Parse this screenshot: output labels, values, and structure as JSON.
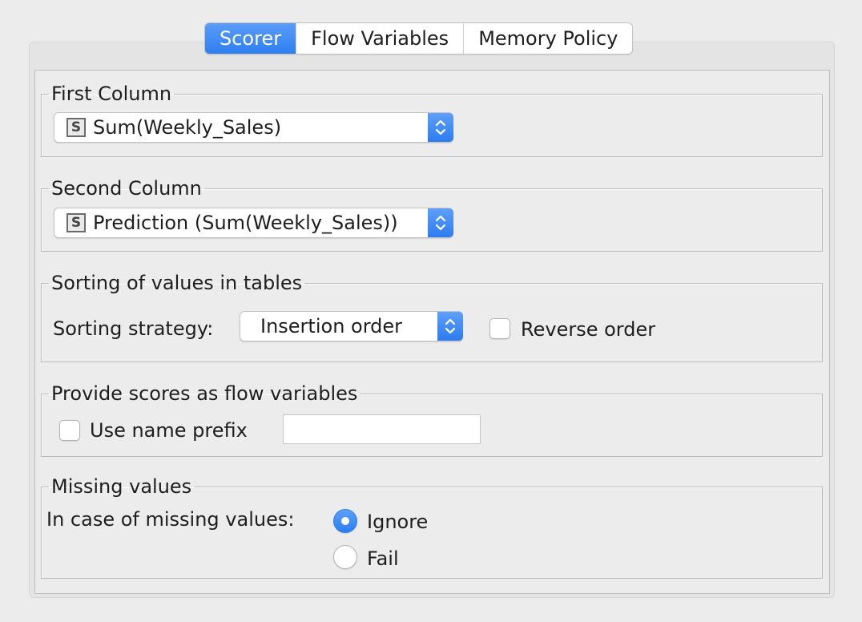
{
  "tabs": [
    {
      "label": "Scorer",
      "active": true
    },
    {
      "label": "Flow Variables",
      "active": false
    },
    {
      "label": "Memory Policy",
      "active": false
    }
  ],
  "first_column": {
    "title": "First Column",
    "type_icon": "S",
    "value": "Sum(Weekly_Sales)"
  },
  "second_column": {
    "title": "Second Column",
    "type_icon": "S",
    "value": "Prediction (Sum(Weekly_Sales))"
  },
  "sorting": {
    "title": "Sorting of values in tables",
    "strategy_label": "Sorting strategy:",
    "strategy_value": "Insertion order",
    "reverse_label": "Reverse order",
    "reverse_checked": false
  },
  "flow_vars": {
    "title": "Provide scores as flow variables",
    "prefix_label": "Use name prefix",
    "prefix_checked": false,
    "prefix_value": ""
  },
  "missing": {
    "title": "Missing values",
    "label": "In case of missing values:",
    "options": [
      {
        "label": "Ignore",
        "selected": true
      },
      {
        "label": "Fail",
        "selected": false
      }
    ]
  },
  "colors": {
    "accent": "#2f7ff1",
    "background": "#ececec"
  },
  "icons": {
    "combo_stepper": "chevron-up-down-icon",
    "column_type": "string-type-icon"
  }
}
